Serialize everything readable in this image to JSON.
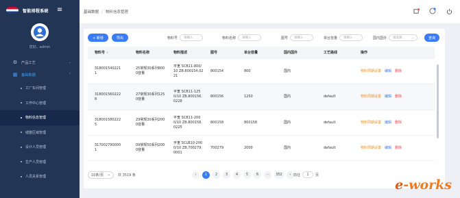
{
  "app": {
    "title": "智能排程系统",
    "greeting": "您好，admin"
  },
  "sidebar": {
    "groups": [
      {
        "label": "产品工艺",
        "open": false
      },
      {
        "label": "基础数据",
        "open": true
      }
    ],
    "items": [
      {
        "label": "工厂车间管理",
        "active": false
      },
      {
        "label": "工作中心管理",
        "active": false
      },
      {
        "label": "物料信息管理",
        "active": true
      },
      {
        "label": "储整区域管理",
        "active": false
      },
      {
        "label": "设计人员管理",
        "active": false
      },
      {
        "label": "生产人员管理",
        "active": false
      },
      {
        "label": "人员关系管理",
        "active": false
      }
    ]
  },
  "breadcrumb": {
    "root": "基础数据",
    "separator": "/",
    "current": "物料信息管理"
  },
  "toolbar": {
    "add_label": "+ 新增",
    "export_label": "导出",
    "search_label": "查询",
    "filters": [
      {
        "label": "物料号",
        "placeholder": "请输入"
      },
      {
        "label": "物料名称",
        "placeholder": "请输入"
      },
      {
        "label": "图号",
        "placeholder": "请输入"
      },
      {
        "label": "单台容量",
        "placeholder": "请输入"
      },
      {
        "label": "国内国外",
        "placeholder": "请选择"
      }
    ]
  },
  "table": {
    "headers": [
      "物料号",
      "物料名称",
      "物料描述",
      "图号",
      "单台容量",
      "国内国外",
      "工艺路线",
      "操作"
    ],
    "rows": [
      {
        "code": [
          "318001540221",
          "1"
        ],
        "name": [
          "25常规30系列800",
          "0容量"
        ],
        "desc": [
          "平宽 SCB11-800/",
          "10 ZB.800154.02",
          "21"
        ],
        "drawing": "800154",
        "capacity": "800",
        "origin": "国内",
        "route": ""
      },
      {
        "code": [
          "318001560222",
          "8"
        ],
        "name": [
          "27常规30系列125",
          "0容量"
        ],
        "desc": [
          "平宽 SCB11-125",
          "0/10 ZB.800156.",
          "0228"
        ],
        "drawing": "800156",
        "capacity": "1250",
        "origin": "国内",
        "route": "default"
      },
      {
        "code": [
          "318001580222",
          "5"
        ],
        "name": [
          "29常规30系列200",
          "0容量"
        ],
        "desc": [
          "平宽 SCB11-200",
          "0/10 ZB.800158.",
          "0225"
        ],
        "drawing": "800158",
        "capacity": "800158",
        "origin": "国内",
        "route": "default"
      },
      {
        "code": [
          "317002790000",
          "1"
        ],
        "name": [
          "09常规50系列200",
          "0容量"
        ],
        "desc": [
          "平宽 SCLB10-200",
          "0/10 ZB.700279.",
          "0001"
        ],
        "drawing": "700279",
        "capacity": "2000",
        "origin": "国内",
        "route": "default"
      }
    ],
    "ops": {
      "settings": "物料周期设置",
      "edit": "编辑",
      "delete": "删除"
    }
  },
  "pagination": {
    "page_size": "10条/页",
    "total": "共 3519 条",
    "pages": [
      "1",
      "2",
      "3",
      "4",
      "5",
      "6",
      "···",
      "352"
    ],
    "current_page": "1",
    "prev": "‹",
    "next": "›",
    "goto_label": "前往",
    "goto_value": "1",
    "goto_unit": "页"
  },
  "watermark": {
    "e": "e",
    "rest": "-works"
  },
  "colors": {
    "sidebar": "#223555",
    "accent": "#3b7cf6",
    "settings_link": "#e8912b",
    "delete_link": "#e54b4b"
  }
}
